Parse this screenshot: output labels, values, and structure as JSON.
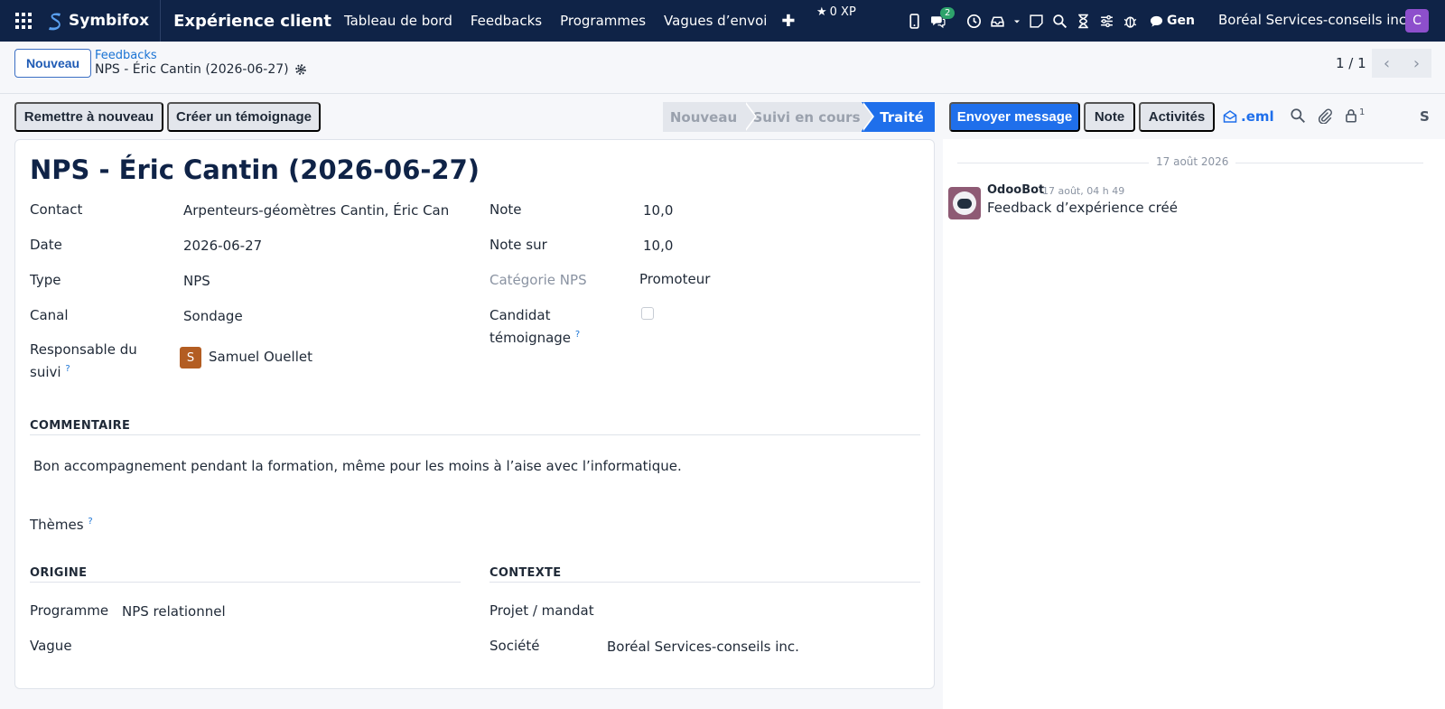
{
  "navbar": {
    "brand": "Symbifox",
    "app_title": "Expérience client",
    "menu": [
      "Tableau de bord",
      "Feedbacks",
      "Programmes",
      "Vagues d’envoi"
    ],
    "xp": "0 XP",
    "chat_badge": "2",
    "gen_label": "Gen",
    "company": "Boréal Services-conseils inc.",
    "user_initial": "C",
    "accent": "#0f2347"
  },
  "control_panel": {
    "new_label": "Nouveau",
    "breadcrumb_parent": "Feedbacks",
    "breadcrumb_current": "NPS - Éric Cantin (2026-06-27)",
    "pager": "1 / 1"
  },
  "actions": {
    "reset": "Remettre à nouveau",
    "testimonial": "Créer un témoignage",
    "send_message": "Envoyer message",
    "note": "Note",
    "activities": "Activités",
    "eml": ".eml",
    "followers_count": "1",
    "s_label": "S"
  },
  "statusbar": {
    "stages": [
      "Nouveau",
      "Suivi en cours",
      "Traité"
    ],
    "active": "Traité",
    "active_color": "#1f6feb"
  },
  "form": {
    "title": "NPS - Éric Cantin (2026-06-27)",
    "left_fields": {
      "contact_label": "Contact",
      "contact_value": "Arpenteurs-géomètres Cantin, Éric Can",
      "date_label": "Date",
      "date_value": "2026-06-27",
      "type_label": "Type",
      "type_value": "NPS",
      "canal_label": "Canal",
      "canal_value": "Sondage",
      "responsable_label_1": "Responsable du",
      "responsable_label_2": "suivi",
      "responsable_initial": "S",
      "responsable_value": "Samuel Ouellet"
    },
    "right_fields": {
      "note_label": "Note",
      "note_value": "10,0",
      "note_sur_label": "Note sur",
      "note_sur_value": "10,0",
      "categorie_label": "Catégorie NPS",
      "categorie_value": "Promoteur",
      "candidat_label_1": "Candidat",
      "candidat_label_2": "témoignage",
      "candidat_checked": false
    },
    "commentaire": {
      "title": "COMMENTAIRE",
      "text": "Bon accompagnement pendant la formation, même pour les moins à l’aise avec l’informatique."
    },
    "themes_label": "Thèmes",
    "origine": {
      "title": "ORIGINE",
      "programme_label": "Programme",
      "programme_value": "NPS relationnel",
      "vague_label": "Vague"
    },
    "contexte": {
      "title": "CONTEXTE",
      "projet_label": "Projet / mandat",
      "societe_label": "Société",
      "societe_value": "Boréal Services-conseils inc."
    }
  },
  "chatter": {
    "date": "17 août 2026",
    "author": "OdooBot",
    "time": "17 août, 04 h 49",
    "message": "Feedback d’expérience créé"
  }
}
